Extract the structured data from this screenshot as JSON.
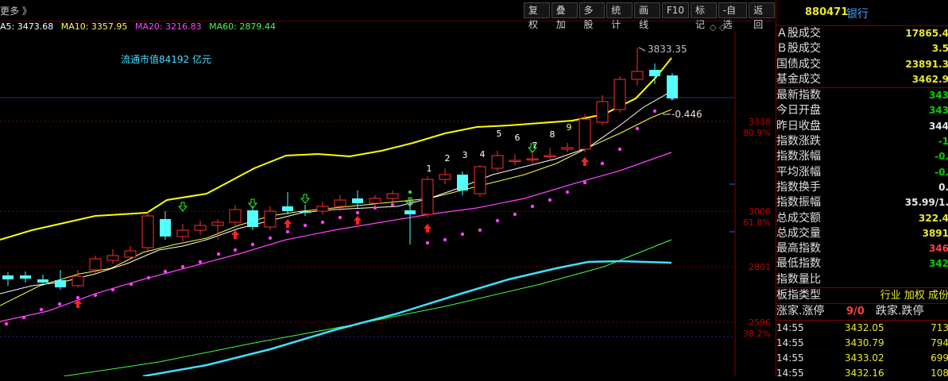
{
  "topbar": {
    "more_label": "更多 》",
    "toolbar": [
      "复权",
      "叠加",
      "多股",
      "统计",
      "画线",
      "F10",
      "标记",
      "-自选",
      "返回"
    ]
  },
  "ma_line": [
    {
      "label": "A5: 3473.68",
      "color": "#ffffff"
    },
    {
      "label": "MA10: 3357.95",
      "color": "#ffff40"
    },
    {
      "label": "MA20: 3216.83",
      "color": "#ff40ff"
    },
    {
      "label": "MA60: 2879.44",
      "color": "#40ff40"
    }
  ],
  "chart_data": {
    "type": "candlestick",
    "float_mv_label": "流通市值",
    "float_mv_value": "84192",
    "float_mv_unit": "亿元",
    "high_label": "3833.35",
    "last_label": "-0.446",
    "price_ticks": [
      {
        "value": 3338,
        "label": "3338",
        "pct": "80.9%"
      },
      {
        "value": 3006,
        "label": "3006",
        "pct": "61.8%"
      },
      {
        "value": 2801,
        "label": "2801",
        "pct": ""
      },
      {
        "value": 2596,
        "label": "2596",
        "pct": "38.2%"
      }
    ],
    "seq_numbers": [
      "1",
      "2",
      "3",
      "4",
      "5",
      "6",
      "7",
      "8",
      "9"
    ],
    "colors": {
      "up": "#ff3030",
      "down": "#54ffff",
      "ma5": "#ffffff",
      "ma10": "#ffff40",
      "ma20": "#ff40ff",
      "ma60": "#40ff40",
      "band": "#ffff00",
      "dots": "#ff40ff",
      "long": "#40e0ff"
    }
  },
  "right_panel": {
    "code": "880471",
    "name": "银行",
    "stats_a": [
      {
        "label": "Ａ股成交",
        "value": "17865.4"
      },
      {
        "label": "Ｂ股成交",
        "value": "3.5"
      },
      {
        "label": "国债成交",
        "value": "23891.3"
      },
      {
        "label": "基金成交",
        "value": "3462.9"
      }
    ],
    "stats_b": [
      {
        "label": "最新指数",
        "value": "343",
        "cls": "green"
      },
      {
        "label": "今日开盘",
        "value": "343",
        "cls": "green"
      },
      {
        "label": "昨日收盘",
        "value": "344",
        "cls": "white"
      },
      {
        "label": "指数涨跌",
        "value": "-1",
        "cls": "green"
      },
      {
        "label": "指数涨幅",
        "value": "-0.",
        "cls": "green"
      },
      {
        "label": "平均涨幅",
        "value": "-0.",
        "cls": "green"
      },
      {
        "label": "指数换手",
        "value": "0.",
        "cls": "white"
      },
      {
        "label": "指数振幅",
        "value": "35.99/1.",
        "cls": "white"
      },
      {
        "label": "总成交额",
        "value": "322.4",
        "cls": ""
      },
      {
        "label": "总成交量",
        "value": "3891",
        "cls": ""
      },
      {
        "label": "最高指数",
        "value": "346",
        "cls": "red"
      },
      {
        "label": "最低指数",
        "value": "342",
        "cls": "green"
      },
      {
        "label": "指数量比",
        "value": "",
        "cls": ""
      }
    ],
    "board_type_label": "板指类型",
    "board_type_value": "行业 加权 成份",
    "updown_label1": "涨家.涨停",
    "updown_value": "9/0",
    "updown_label2": "跌家.跌停",
    "ticks": [
      {
        "time": "14:55",
        "price": "3432.05",
        "vol": "713"
      },
      {
        "time": "14:55",
        "price": "3430.79",
        "vol": "794"
      },
      {
        "time": "14:55",
        "price": "3433.02",
        "vol": "699"
      },
      {
        "time": "14:55",
        "price": "3432.16",
        "vol": "108"
      }
    ]
  }
}
